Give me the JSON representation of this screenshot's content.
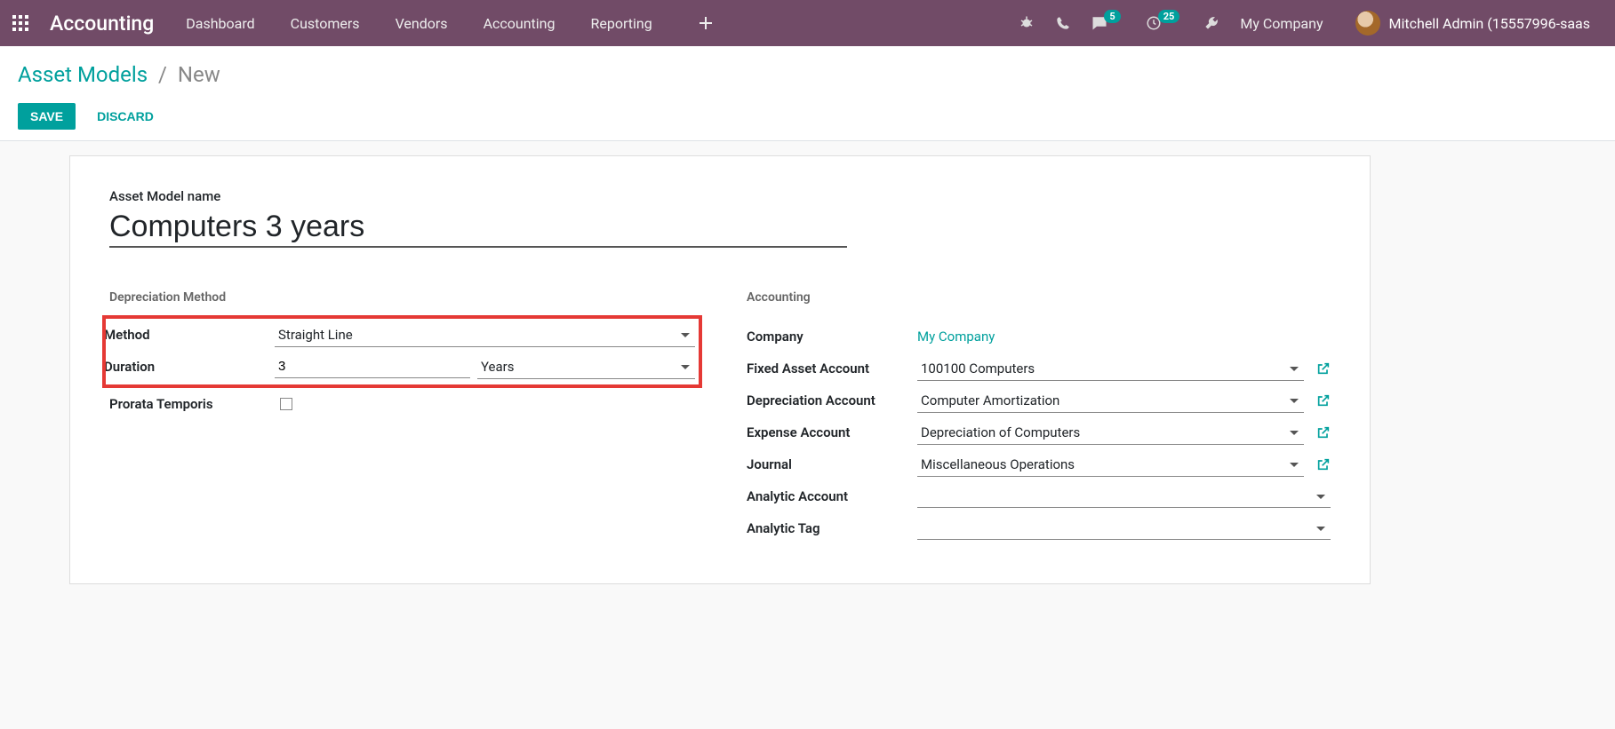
{
  "nav": {
    "app_title": "Accounting",
    "menu": [
      "Dashboard",
      "Customers",
      "Vendors",
      "Accounting",
      "Reporting"
    ],
    "badge_messages": "5",
    "badge_activities": "25",
    "company": "My Company",
    "user": "Mitchell Admin (15557996-saas"
  },
  "breadcrumb": {
    "root": "Asset Models",
    "sep": "/",
    "current": "New"
  },
  "buttons": {
    "save": "SAVE",
    "discard": "DISCARD"
  },
  "form": {
    "name_label": "Asset Model name",
    "name_value": "Computers 3 years",
    "left_group_title": "Depreciation Method",
    "right_group_title": "Accounting",
    "fields": {
      "method_label": "Method",
      "method_value": "Straight Line",
      "duration_label": "Duration",
      "duration_number": "3",
      "duration_unit": "Years",
      "prorata_label": "Prorata Temporis",
      "company_label": "Company",
      "company_value": "My Company",
      "fixed_asset_label": "Fixed Asset Account",
      "fixed_asset_value": "100100 Computers",
      "deprec_acc_label": "Depreciation Account",
      "deprec_acc_value": "Computer Amortization",
      "expense_acc_label": "Expense Account",
      "expense_acc_value": "Depreciation of Computers",
      "journal_label": "Journal",
      "journal_value": "Miscellaneous Operations",
      "analytic_acc_label": "Analytic Account",
      "analytic_tag_label": "Analytic Tag"
    }
  }
}
